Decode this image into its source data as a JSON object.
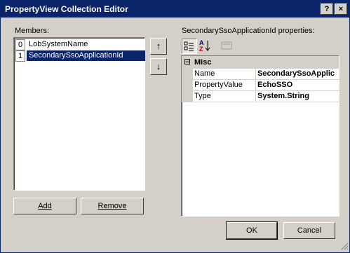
{
  "window": {
    "title": "PropertyView Collection Editor",
    "help_label": "?",
    "close_label": "×"
  },
  "members": {
    "label": "Members:",
    "items": [
      {
        "index": "0",
        "label": "LobSystemName",
        "selected": false
      },
      {
        "index": "1",
        "label": "SecondarySsoApplicationId",
        "selected": true
      }
    ],
    "add_label": "Add",
    "remove_label": "Remove"
  },
  "order_buttons": {
    "up_label": "↑",
    "down_label": "↓"
  },
  "properties": {
    "label": "SecondarySsoApplicationId properties:",
    "category": {
      "toggle": "⊟",
      "name": "Misc"
    },
    "rows": [
      {
        "name": "Name",
        "value": "SecondarySsoApplic"
      },
      {
        "name": "PropertyValue",
        "value": "EchoSSO"
      },
      {
        "name": "Type",
        "value": "System.String"
      }
    ]
  },
  "footer": {
    "ok_label": "OK",
    "cancel_label": "Cancel"
  }
}
